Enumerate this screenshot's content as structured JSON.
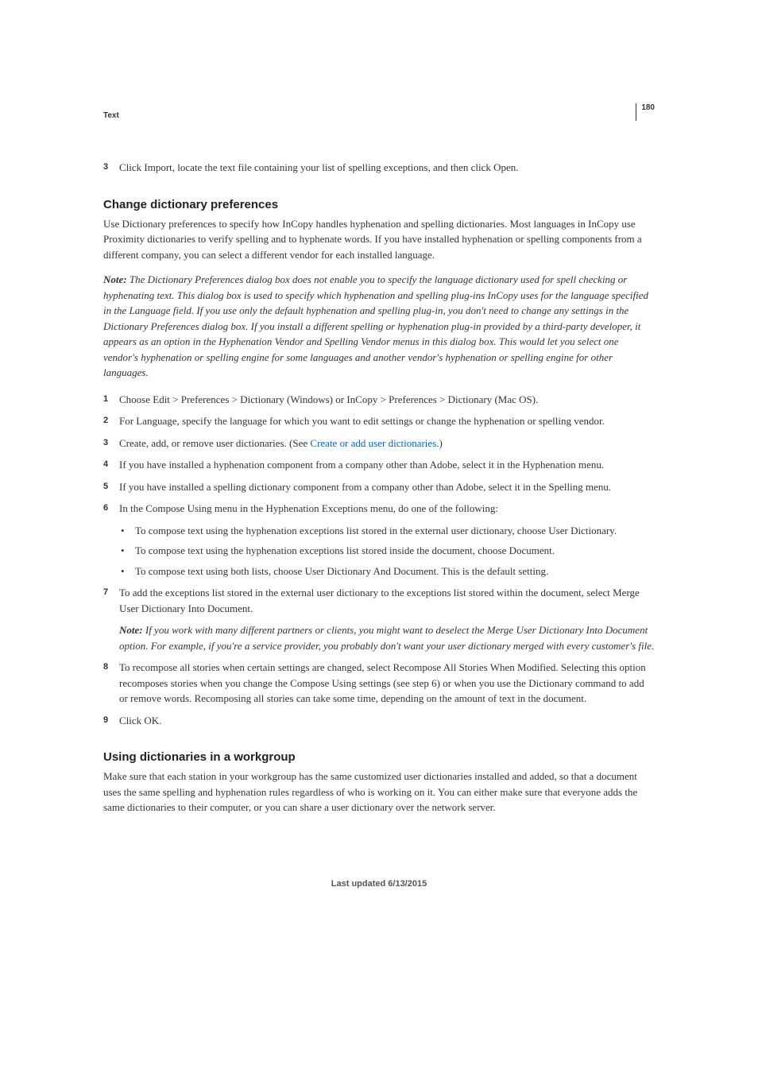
{
  "header": {
    "section": "Text",
    "page_number": "180"
  },
  "intro_step": {
    "num": "3",
    "text": "Click Import, locate the text file containing your list of spelling exceptions, and then click Open."
  },
  "section1": {
    "heading": "Change dictionary preferences",
    "para": "Use Dictionary preferences to specify how InCopy handles hyphenation and spelling dictionaries. Most languages in InCopy use Proximity dictionaries to verify spelling and to hyphenate words. If you have installed hyphenation or spelling components from a different company, you can select a different vendor for each installed language.",
    "note_label": "Note:",
    "note_text": " The Dictionary Preferences dialog box does not enable you to specify the language dictionary used for spell checking or hyphenating text. This dialog box is used to specify which hyphenation and spelling plug-ins InCopy uses for the language specified in the Language field. If you use only the default hyphenation and spelling plug-in, you don't need to change any settings in the Dictionary Preferences dialog box. If you install a different spelling or hyphenation plug-in provided by a third-party developer, it appears as an option in the Hyphenation Vendor and Spelling Vendor menus in this dialog box. This would let you select one vendor's hyphenation or spelling engine for some languages and another vendor's hyphenation or spelling engine for other languages.",
    "steps": [
      {
        "num": "1",
        "text": "Choose Edit > Preferences > Dictionary (Windows) or InCopy > Preferences > Dictionary (Mac OS)."
      },
      {
        "num": "2",
        "text": "For Language, specify the language for which you want to edit settings or change the hyphenation or spelling vendor."
      },
      {
        "num": "3",
        "pre": "Create, add, or remove user dictionaries. (See ",
        "link": "Create or add user dictionaries",
        "post": ".)"
      },
      {
        "num": "4",
        "text": "If you have installed a hyphenation component from a company other than Adobe, select it in the Hyphenation menu."
      },
      {
        "num": "5",
        "text": "If you have installed a spelling dictionary component from a company other than Adobe, select it in the Spelling menu."
      },
      {
        "num": "6",
        "text": "In the Compose Using menu in the Hyphenation Exceptions menu, do one of the following:"
      }
    ],
    "bullets": [
      "To compose text using the hyphenation exceptions list stored in the external user dictionary, choose User Dictionary.",
      "To compose text using the hyphenation exceptions list stored inside the document, choose Document.",
      "To compose text using both lists, choose User Dictionary And Document. This is the default setting."
    ],
    "step7": {
      "num": "7",
      "text": "To add the exceptions list stored in the external user dictionary to the exceptions list stored within the document, select Merge User Dictionary Into Document.",
      "note_label": "Note:",
      "note_text": " If you work with many different partners or clients, you might want to deselect the Merge User Dictionary Into Document option. For example, if you're a service provider, you probably don't want your user dictionary merged with every customer's file."
    },
    "step8": {
      "num": "8",
      "text": "To recompose all stories when certain settings are changed, select Recompose All Stories When Modified. Selecting this option recomposes stories when you change the Compose Using settings (see step 6) or when you use the Dictionary command to add or remove words. Recomposing all stories can take some time, depending on the amount of text in the document."
    },
    "step9": {
      "num": "9",
      "text": "Click OK."
    }
  },
  "section2": {
    "heading": "Using dictionaries in a workgroup",
    "para": "Make sure that each station in your workgroup has the same customized user dictionaries installed and added, so that a document uses the same spelling and hyphenation rules regardless of who is working on it. You can either make sure that everyone adds the same dictionaries to their computer, or you can share a user dictionary over the network server."
  },
  "footer": "Last updated 6/13/2015"
}
